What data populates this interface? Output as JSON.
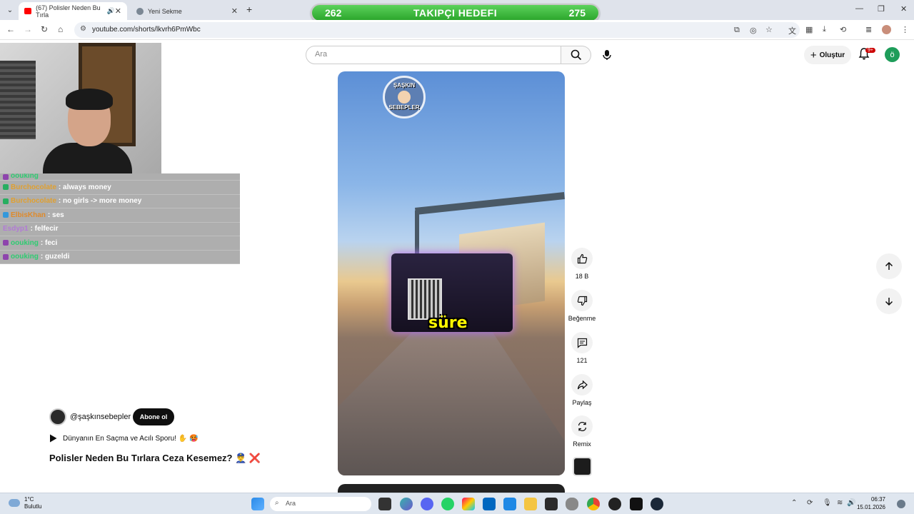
{
  "browser": {
    "tabs": [
      {
        "title": "(67) Polisler Neden Bu Tırla",
        "active": true
      },
      {
        "title": "Yeni Sekme",
        "active": false
      }
    ],
    "url": "youtube.com/shorts/lkvrh6PmWbc",
    "new_tab_symbol": "+",
    "window_controls": [
      "—",
      "❐",
      "✕"
    ]
  },
  "goal_overlay": {
    "current": "262",
    "title": "TAKIPÇI HEDEFI",
    "target": "275"
  },
  "youtube_header": {
    "search_placeholder": "Ara",
    "create_label": "Oluştur",
    "notifications_badge": "9+",
    "user_initial": "ö"
  },
  "chat": [
    {
      "user": "oouking",
      "message": "",
      "user_color": "#2ecc71"
    },
    {
      "user": "Burchocolate",
      "message": ": always money",
      "user_color": "#e0a030"
    },
    {
      "user": "Burchocolate",
      "message": ": no girls -> more money",
      "user_color": "#e0a030"
    },
    {
      "user": "ElbisKhan",
      "message": ": ses",
      "user_color": "#e08a2a"
    },
    {
      "user": "Esdyp1",
      "message": ": felfecir",
      "user_color": "#b27ad6"
    },
    {
      "user": "oouking",
      "message": ": feci",
      "user_color": "#2ecc71"
    },
    {
      "user": "oouking",
      "message": ": guzeldi",
      "user_color": "#2ecc71"
    }
  ],
  "video": {
    "caption": "süre",
    "logo_top": "ŞAŞKIN",
    "logo_bottom": "SEBEPLER"
  },
  "actions": {
    "likes": "18 B",
    "dislike_label": "Beğenme",
    "comments": "121",
    "share_label": "Paylaş",
    "remix_label": "Remix"
  },
  "channel": {
    "handle": "@şaşkınsebepler",
    "subscribe_label": "Abone ol",
    "playlist_title": "Dünyanın En Saçma ve Acılı Sporu! ✋ 🥵",
    "short_title": "Polisler Neden Bu Tırlara Ceza Kesemez? 👮‍♂️ ❌"
  },
  "taskbar": {
    "weather_temp": "1°C",
    "weather_desc": "Bulutlu",
    "search_placeholder": "Ara",
    "time": "06:37",
    "date": "15.01.2026"
  }
}
